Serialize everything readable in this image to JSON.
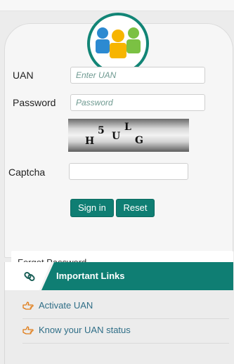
{
  "form": {
    "uan_label": "UAN",
    "uan_placeholder": "Enter UAN",
    "password_label": "Password",
    "password_placeholder": "Password",
    "captcha_label": "Captcha",
    "captcha_text": "H5ULG",
    "captcha_value": "",
    "signin_label": "Sign in",
    "reset_label": "Reset",
    "forgot_label": "Forgot Password"
  },
  "links": {
    "title": "Important Links",
    "items": [
      {
        "label": "Activate UAN",
        "icon": "hand-pointing-icon"
      },
      {
        "label": "Know your UAN status",
        "icon": "hand-pointing-icon"
      }
    ]
  },
  "colors": {
    "accent": "#0f7e73",
    "link": "#2f6e87",
    "icon": "#e07b16"
  }
}
